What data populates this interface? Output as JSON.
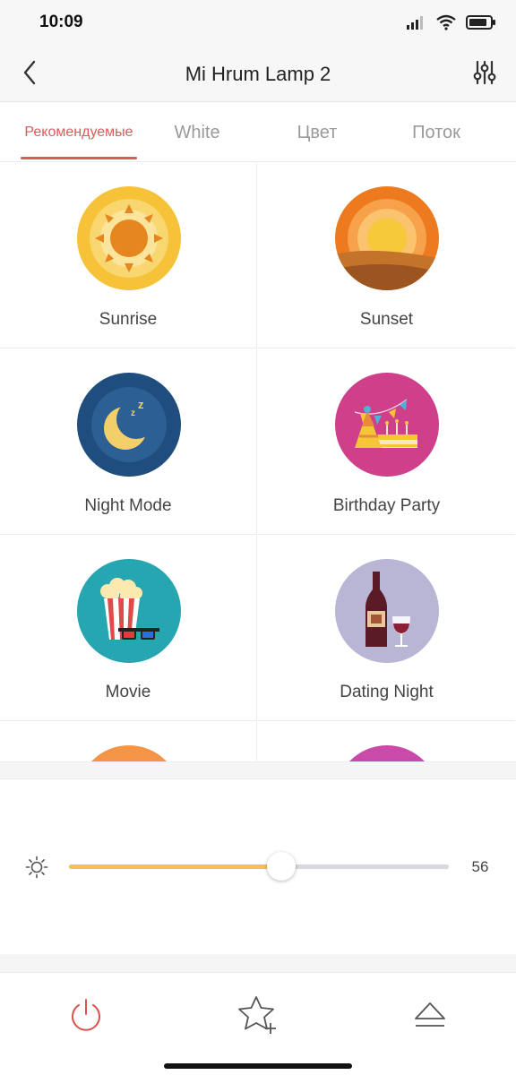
{
  "status_bar": {
    "time": "10:09",
    "icons": [
      "signal-icon",
      "wifi-icon",
      "battery-icon"
    ]
  },
  "header": {
    "title": "Mi Hrum Lamp 2",
    "back_icon": "chevron-left-icon",
    "settings_icon": "sliders-icon"
  },
  "tabs": [
    {
      "label": "Рекомендуемые",
      "active": true
    },
    {
      "label": "White",
      "active": false
    },
    {
      "label": "Цвет",
      "active": false
    },
    {
      "label": "Поток",
      "active": false
    }
  ],
  "scenes": [
    {
      "label": "Sunrise",
      "icon": "sunrise-icon"
    },
    {
      "label": "Sunset",
      "icon": "sunset-icon"
    },
    {
      "label": "Night Mode",
      "icon": "night-mode-icon"
    },
    {
      "label": "Birthday Party",
      "icon": "birthday-party-icon"
    },
    {
      "label": "Movie",
      "icon": "movie-icon"
    },
    {
      "label": "Dating Night",
      "icon": "dating-night-icon"
    }
  ],
  "brightness": {
    "icon": "brightness-sun-icon",
    "value": "56",
    "level_fraction": 0.56
  },
  "bottom_nav": [
    {
      "icon": "power-icon"
    },
    {
      "icon": "add-favorite-star-icon"
    },
    {
      "icon": "eject-icon"
    }
  ],
  "colors": {
    "accent": "#e05a5a",
    "slider_fill": "#f0c24e",
    "slider_track": "#d8d8de"
  }
}
